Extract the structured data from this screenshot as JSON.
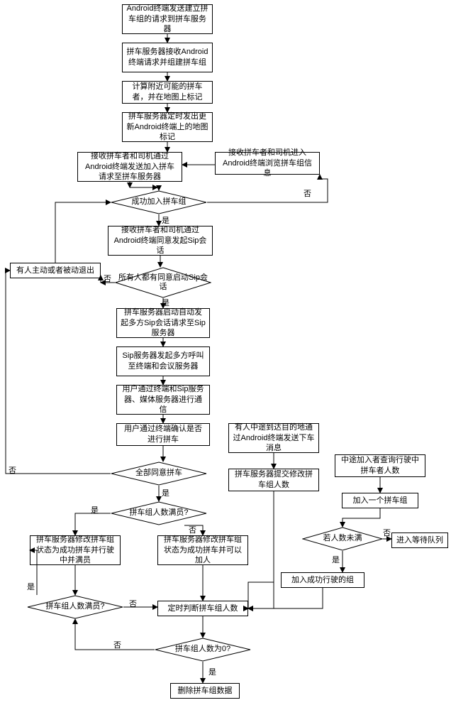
{
  "chart_data": {
    "type": "flowchart",
    "title": "",
    "nodes": [
      {
        "id": "n1",
        "type": "process",
        "text": "Android终端发送建立拼车组的请求到拼车服务器"
      },
      {
        "id": "n2",
        "type": "process",
        "text": "拼车服务器接收Android终端请求并组建拼车组"
      },
      {
        "id": "n3",
        "type": "process",
        "text": "计算附近可能的拼车者，并在地图上标记"
      },
      {
        "id": "n4",
        "type": "process",
        "text": "拼车服务器定时发出更新Android终端上的地图标记"
      },
      {
        "id": "n5",
        "type": "process",
        "text": "接收拼车者和司机通过Android终端发送加入拼车请求至拼车服务器"
      },
      {
        "id": "n5b",
        "type": "process",
        "text": "接收拼车者和司机进入Android终端浏览拼车组信息"
      },
      {
        "id": "d1",
        "type": "decision",
        "text": "成功加入拼车组"
      },
      {
        "id": "n6",
        "type": "process",
        "text": "接收拼车者和司机通过Android终端同意发起Sip会话"
      },
      {
        "id": "l1",
        "type": "process",
        "text": "有人主动或者被动退出"
      },
      {
        "id": "d2",
        "type": "decision",
        "text": "所有人都有同意启动Sip会话"
      },
      {
        "id": "n7",
        "type": "process",
        "text": "拼车服务器启动自动发起多方Sip会话请求至Sip服务器"
      },
      {
        "id": "n8",
        "type": "process",
        "text": "Sip服务器发起多方呼叫至终端和会议服务器"
      },
      {
        "id": "n9",
        "type": "process",
        "text": "用户通过终端和Sip服务器、媒体服务器进行通信"
      },
      {
        "id": "n10",
        "type": "process",
        "text": "用户通过终端确认是否进行拼车"
      },
      {
        "id": "d3",
        "type": "decision",
        "text": "全部同意拼车"
      },
      {
        "id": "d4",
        "type": "decision",
        "text": "拼车组人数满员?"
      },
      {
        "id": "n11",
        "type": "process",
        "text": "拼车服务器修改拼车组状态为成功拼车并行驶中并满员"
      },
      {
        "id": "n12",
        "type": "process",
        "text": "拼车服务器修改拼车组状态为成功拼车并可以加人"
      },
      {
        "id": "d5",
        "type": "decision",
        "text": "拼车组人数满员?"
      },
      {
        "id": "n13",
        "type": "process",
        "text": "定时判断拼车组人数"
      },
      {
        "id": "d6",
        "type": "decision",
        "text": "拼车组人数为0?"
      },
      {
        "id": "n14",
        "type": "process",
        "text": "删除拼车组数据"
      },
      {
        "id": "r1",
        "type": "process",
        "text": "有人中途到达目的地通过Android终端发送下车消息"
      },
      {
        "id": "r2",
        "type": "process",
        "text": "拼车服务器提交修改拼车组人数"
      },
      {
        "id": "r3",
        "type": "process",
        "text": "中途加入者查询行驶中拼车者人数"
      },
      {
        "id": "r4",
        "type": "process",
        "text": "加入一个拼车组"
      },
      {
        "id": "dr",
        "type": "decision",
        "text": "若人数未满"
      },
      {
        "id": "r5",
        "type": "process",
        "text": "加入成功行驶的组"
      },
      {
        "id": "r6",
        "type": "process",
        "text": "进入等待队列"
      }
    ],
    "edges": [
      {
        "from": "n1",
        "to": "n2"
      },
      {
        "from": "n2",
        "to": "n3"
      },
      {
        "from": "n3",
        "to": "n4"
      },
      {
        "from": "n4",
        "to": "n5"
      },
      {
        "from": "n5b",
        "to": "n5"
      },
      {
        "from": "n5",
        "to": "d1"
      },
      {
        "from": "d1",
        "to": "n5b",
        "label": "否"
      },
      {
        "from": "d1",
        "to": "n6",
        "label": "是"
      },
      {
        "from": "n6",
        "to": "d2"
      },
      {
        "from": "d2",
        "to": "l1",
        "label": "否"
      },
      {
        "from": "l1",
        "to": "d1"
      },
      {
        "from": "d2",
        "to": "n7",
        "label": "是"
      },
      {
        "from": "n7",
        "to": "n8"
      },
      {
        "from": "n8",
        "to": "n9"
      },
      {
        "from": "n9",
        "to": "n10"
      },
      {
        "from": "n10",
        "to": "d3"
      },
      {
        "from": "d3",
        "to": "l1",
        "label": "否"
      },
      {
        "from": "d3",
        "to": "d4",
        "label": "是"
      },
      {
        "from": "d4",
        "to": "n11",
        "label": "是"
      },
      {
        "from": "d4",
        "to": "n12",
        "label": "否"
      },
      {
        "from": "n11",
        "to": "d5"
      },
      {
        "from": "n12",
        "to": "n13"
      },
      {
        "from": "d5",
        "to": "n13",
        "label": "否"
      },
      {
        "from": "d5",
        "to": "n11",
        "label": "是"
      },
      {
        "from": "n13",
        "to": "d6"
      },
      {
        "from": "d6",
        "to": "d5",
        "label": "否"
      },
      {
        "from": "d6",
        "to": "n14",
        "label": "是"
      },
      {
        "from": "r1",
        "to": "r2"
      },
      {
        "from": "r2",
        "to": "n13"
      },
      {
        "from": "r3",
        "to": "r4"
      },
      {
        "from": "r4",
        "to": "dr"
      },
      {
        "from": "dr",
        "to": "r5",
        "label": "是"
      },
      {
        "from": "dr",
        "to": "r6",
        "label": "否"
      },
      {
        "from": "r5",
        "to": "n13"
      }
    ]
  },
  "labels": {
    "yes": "是",
    "no": "否"
  }
}
